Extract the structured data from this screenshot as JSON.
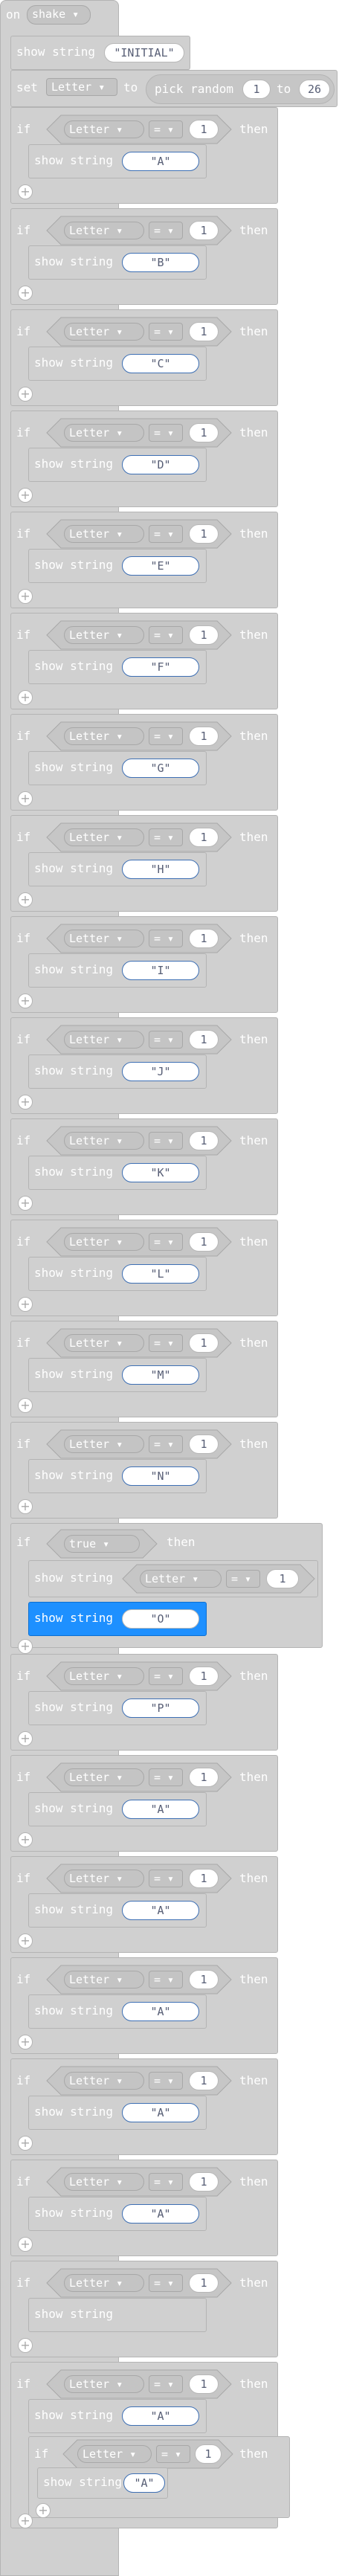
{
  "hat": {
    "on": "on",
    "event": "shake"
  },
  "init": {
    "label": "show string",
    "value": "\"INITIAL\""
  },
  "set": {
    "label_set": "set",
    "variable": "Letter",
    "label_to": "to",
    "label_random": "pick random",
    "min": "1",
    "label_to2": "to",
    "max": "26"
  },
  "cond": {
    "if": "if",
    "variable": "Letter",
    "op": "=",
    "value": "1",
    "then": "then"
  },
  "show_label": "show string",
  "true_label": "true",
  "letters": [
    "\"A\"",
    "\"B\"",
    "\"C\"",
    "\"D\"",
    "\"E\"",
    "\"F\"",
    "\"G\"",
    "\"H\"",
    "\"I\"",
    "\"J\"",
    "\"K\"",
    "\"L\"",
    "\"M\"",
    "\"N\""
  ],
  "special": {
    "show_string_value": "Letter",
    "show_string_op": "=",
    "show_string_num": "1",
    "selected_value": "\"O\""
  },
  "letters2": [
    "\"P\"",
    "\"A\"",
    "\"A\"",
    "\"A\"",
    "\"A\"",
    "\"A\"",
    "",
    "\"A\""
  ],
  "nested": {
    "if": "if",
    "variable": "Letter",
    "op": "=",
    "value": "1",
    "then": "then",
    "show_value": "\"A\""
  },
  "colors": {
    "block": "#d0d0d0",
    "selected": "#1e90ff",
    "text": "#ffffff"
  }
}
